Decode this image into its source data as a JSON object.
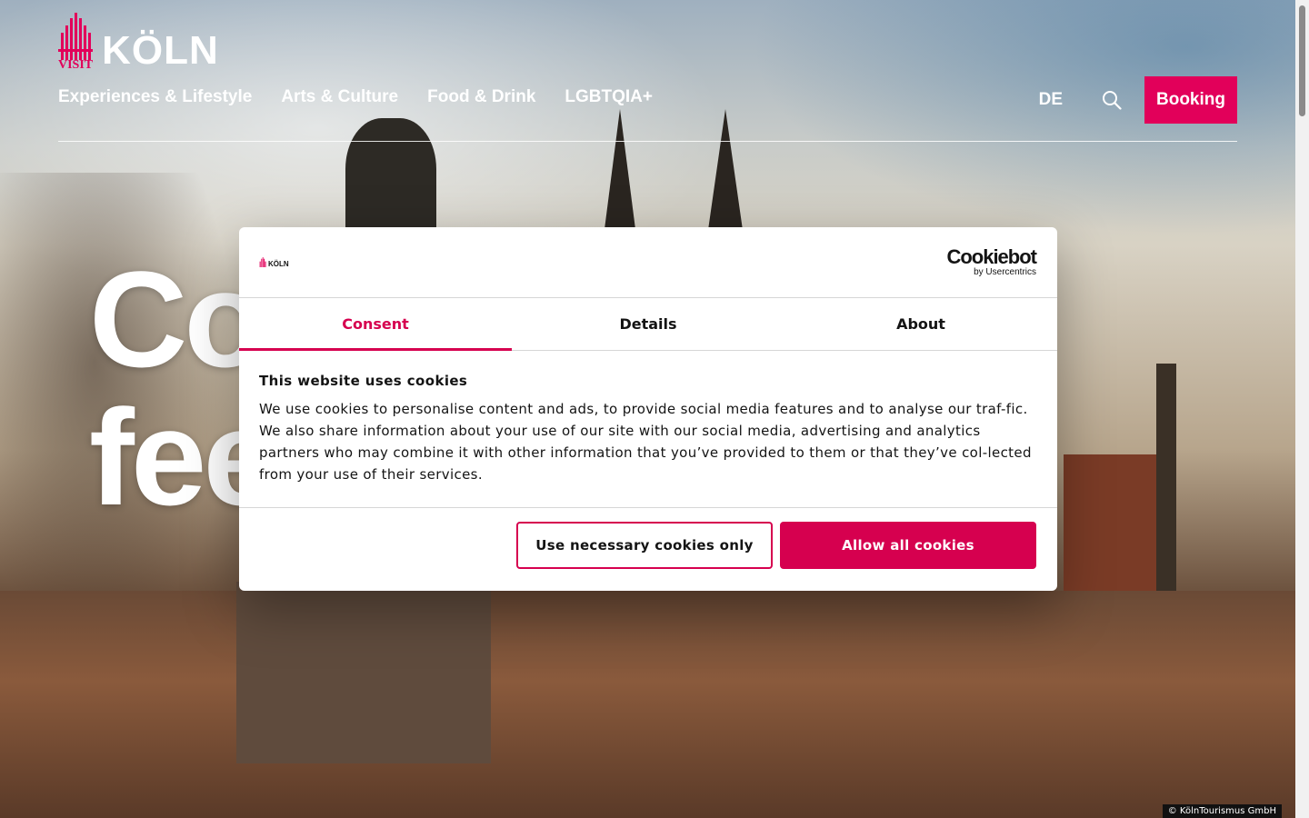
{
  "header": {
    "logo_visit": "VISIT",
    "logo_city": "KÖLN",
    "nav": [
      "Experiences & Lifestyle",
      "Arts & Culture",
      "Food & Drink",
      "LGBTQIA+"
    ],
    "language": "DE",
    "search_icon": "search-icon",
    "booking_label": "Booking"
  },
  "hero": {
    "line1": "Co",
    "line2": "fee",
    "copyright": "© KölnTourismus GmbH"
  },
  "cookie_dialog": {
    "logo_city": "KÖLN",
    "provider_name": "Cookiebot",
    "provider_sub": "by Usercentrics",
    "tabs": [
      "Consent",
      "Details",
      "About"
    ],
    "active_tab": "Consent",
    "title": "This website uses cookies",
    "text": "We use cookies to personalise content and ads, to provide social media features and to analyse our traf-fic. We also share information about your use of our site with our social media, advertising and analytics partners who may combine it with other information that you’ve provided to them or that they’ve col-lected from your use of their services.",
    "btn_necessary": "Use necessary cookies only",
    "btn_allow": "Allow all cookies"
  },
  "colors": {
    "brand": "#e2005a",
    "accent": "#d6004f"
  }
}
